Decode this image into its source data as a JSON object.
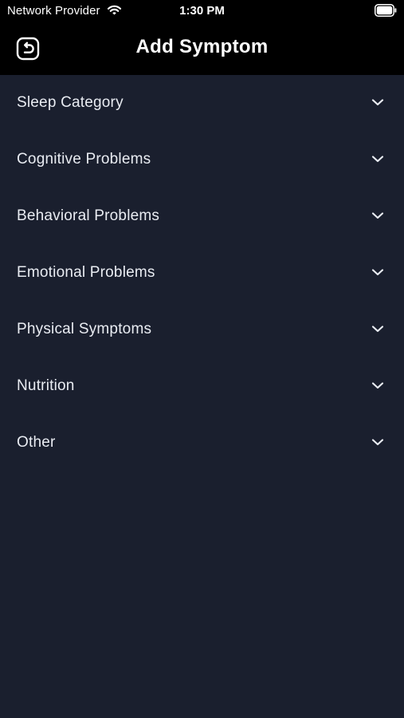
{
  "status_bar": {
    "carrier": "Network Provider",
    "time": "1:30 PM",
    "wifi_icon": "wifi-icon",
    "battery_icon": "battery-icon"
  },
  "header": {
    "title": "Add Symptom",
    "back_icon": "back-return-icon"
  },
  "categories": [
    {
      "label": "Sleep Category"
    },
    {
      "label": "Cognitive Problems"
    },
    {
      "label": "Behavioral Problems"
    },
    {
      "label": "Emotional Problems"
    },
    {
      "label": "Physical Symptoms"
    },
    {
      "label": "Nutrition"
    },
    {
      "label": "Other"
    }
  ],
  "colors": {
    "header_bg": "#000000",
    "content_bg": "#1a1f2e",
    "text": "#e9ecf2"
  }
}
